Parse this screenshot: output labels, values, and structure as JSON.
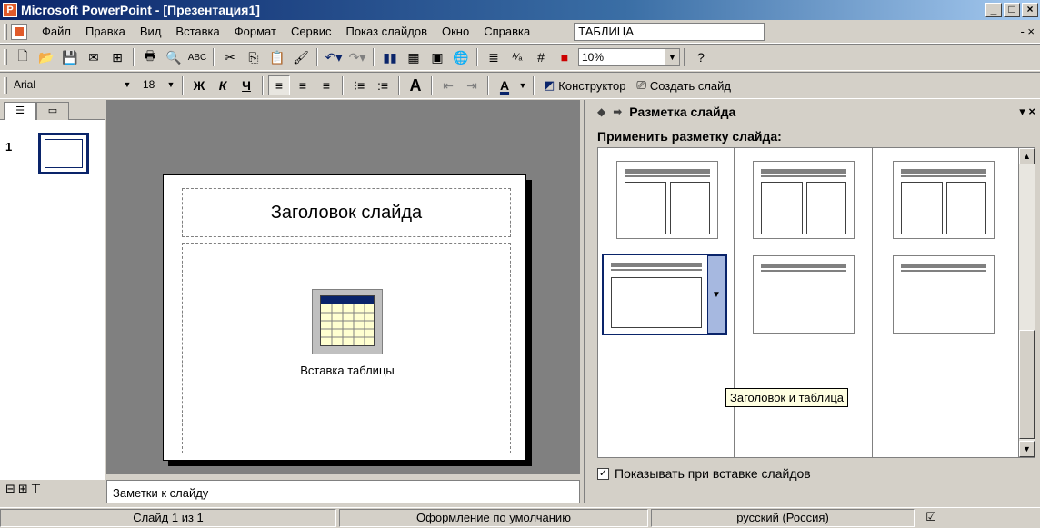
{
  "window": {
    "title": "Microsoft PowerPoint - [Презентация1]",
    "minimize": "_",
    "maximize": "□",
    "close": "×"
  },
  "menu": {
    "items": [
      "Файл",
      "Правка",
      "Вид",
      "Вставка",
      "Формат",
      "Сервис",
      "Показ слайдов",
      "Окно",
      "Справка"
    ],
    "help_box": "ТАБЛИЦА",
    "end_symbol": "- ×"
  },
  "toolbar_standard": {
    "zoom": "10%"
  },
  "toolbar_formatting": {
    "font": "Arial",
    "size": "18",
    "bold": "Ж",
    "italic": "К",
    "underline": "Ч",
    "designer": "Конструктор",
    "new_slide": "Создать слайд"
  },
  "slide_panel": {
    "slide_number": "1"
  },
  "slide": {
    "title_placeholder": "Заголовок слайда",
    "insert_table": "Вставка таблицы"
  },
  "notes": {
    "placeholder": "Заметки к слайду"
  },
  "task_pane": {
    "title": "Разметка слайда",
    "apply_label": "Применить разметку слайда:",
    "tooltip": "Заголовок и таблица",
    "show_on_insert": "Показывать при вставке слайдов"
  },
  "status": {
    "slide": "Слайд 1 из 1",
    "design": "Оформление по умолчанию",
    "language": "русский (Россия)"
  },
  "colors": {
    "title_bar_start": "#0a246a",
    "title_bar_end": "#a6caf0",
    "selection": "#0a246a"
  }
}
